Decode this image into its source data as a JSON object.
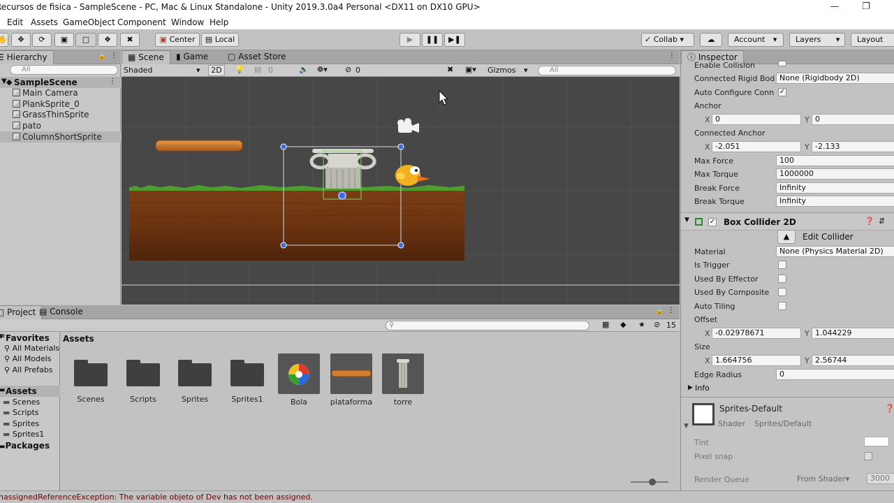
{
  "window": {
    "title": "Recursos de fisica - SampleScene - PC, Mac & Linux Standalone - Unity 2019.3.0a4 Personal <DX11 on DX10 GPU>"
  },
  "menu": [
    "Edit",
    "Assets",
    "GameObject",
    "Component",
    "Window",
    "Help"
  ],
  "toolbar": {
    "pivot": "Center",
    "space": "Local",
    "collab": "Collab",
    "account": "Account",
    "layers": "Layers",
    "layout": "Layout"
  },
  "hierarchy": {
    "tab": "Hierarchy",
    "search_placeholder": "All",
    "scene": "SampleScene",
    "items": [
      "Main Camera",
      "PlankSprite_0",
      "GrassThinSprite",
      "pato",
      "ColumnShortSprite"
    ]
  },
  "scene": {
    "tabs": [
      "Scene",
      "Game",
      "Asset Store"
    ],
    "shading": "Shaded",
    "mode_2d": "2D",
    "fx_count": "0",
    "hidden_count": "0",
    "gizmos": "Gizmos",
    "search_placeholder": "All"
  },
  "project": {
    "tabs": [
      "Project",
      "Console"
    ],
    "count": "15",
    "breadcrumb": "Assets",
    "favorites_title": "Favorites",
    "favorites": [
      "All Materials",
      "All Models",
      "All Prefabs"
    ],
    "assets_title": "Assets",
    "folders": [
      "Scenes",
      "Scripts",
      "Sprites",
      "Sprites1"
    ],
    "packages_title": "Packages",
    "items": [
      {
        "name": "Scenes",
        "kind": "folder"
      },
      {
        "name": "Scripts",
        "kind": "folder"
      },
      {
        "name": "Sprites",
        "kind": "folder"
      },
      {
        "name": "Sprites1",
        "kind": "folder"
      },
      {
        "name": "Bola",
        "kind": "ball"
      },
      {
        "name": "plataforma",
        "kind": "plank"
      },
      {
        "name": "torre",
        "kind": "column"
      }
    ]
  },
  "inspector": {
    "tab": "Inspector",
    "enable_collision": "Enable Collision",
    "connected_rb_label": "Connected Rigid Bod",
    "connected_rb_value": "None (Rigidbody 2D)",
    "auto_configure": "Auto Configure Conn",
    "auto_configure_check": "✓",
    "anchor_label": "Anchor",
    "anchor_x": "0",
    "anchor_y": "0",
    "conn_anchor_label": "Connected Anchor",
    "conn_anchor_x": "-2.051",
    "conn_anchor_y": "-2.133",
    "max_force_label": "Max Force",
    "max_force": "100",
    "max_torque_label": "Max Torque",
    "max_torque": "1000000",
    "break_force_label": "Break Force",
    "break_force": "Infinity",
    "break_torque_label": "Break Torque",
    "break_torque": "Infinity",
    "box_collider_title": "Box Collider 2D",
    "box_collider_check": "✓",
    "edit_collider": "Edit Collider",
    "material_label": "Material",
    "material_value": "None (Physics Material 2D)",
    "is_trigger": "Is Trigger",
    "used_by_effector": "Used By Effector",
    "used_by_composite": "Used By Composite",
    "auto_tiling": "Auto Tiling",
    "offset_label": "Offset",
    "offset_x": "-0.02978671",
    "offset_y": "1.044229",
    "size_label": "Size",
    "size_x": "1.664756",
    "size_y": "2.56744",
    "edge_radius_label": "Edge Radius",
    "edge_radius": "0",
    "info_label": "Info",
    "material_name": "Sprites-Default",
    "shader_label": "Shader",
    "shader_value": "Sprites/Default",
    "tint_label": "Tint",
    "pixel_snap_label": "Pixel snap",
    "render_queue_label": "Render Queue",
    "render_queue_mode": "From Shader",
    "render_queue_value": "3000"
  },
  "status": {
    "message": "UnassignedReferenceException: The variable objeto of Dev has not been assigned."
  },
  "colors": {
    "selection_blue": "#3d6ad8",
    "grass": "#4f9c2f",
    "ground": "#6b3311",
    "status_error": "#6b0000"
  }
}
